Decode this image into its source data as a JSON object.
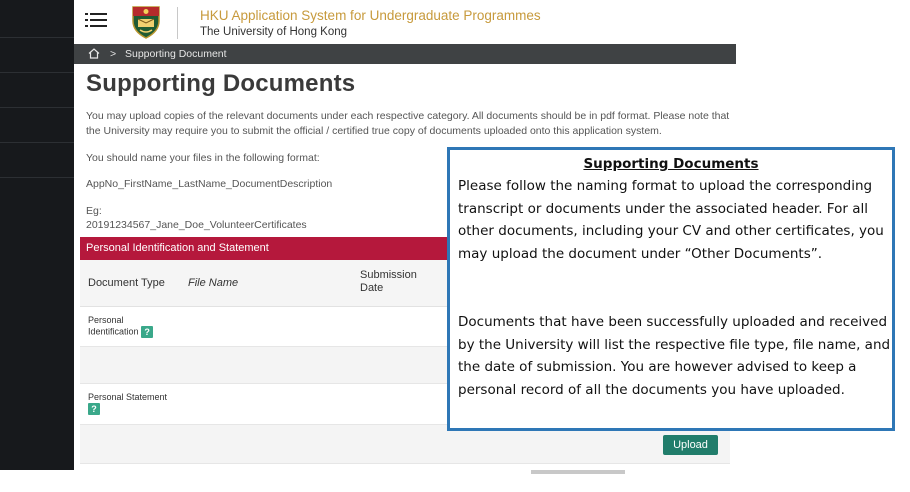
{
  "header": {
    "app_title": "HKU Application System for Undergraduate Programmes",
    "university": "The University of Hong Kong"
  },
  "breadcrumb": {
    "current": "Supporting Document"
  },
  "page": {
    "title": "Supporting Documents",
    "intro": "You may upload copies of the relevant documents under each respective category. All documents should be in pdf format. Please note that the University may require you to submit the official / certified true copy of documents uploaded onto this application system.",
    "naming_hint": "You should name your files in the following format:",
    "naming_format": "AppNo_FirstName_LastName_DocumentDescription",
    "eg_label": "Eg:",
    "eg_value": "20191234567_Jane_Doe_VolunteerCertificates"
  },
  "section": {
    "title": "Personal Identification and Statement",
    "columns": {
      "doc_type": "Document Type",
      "file_name": "File Name",
      "submission_date": "Submission Date"
    },
    "rows": [
      {
        "label": "Personal Identification",
        "help": "?"
      },
      {
        "label": "Personal Statement",
        "help": "?"
      }
    ],
    "upload_label": "Upload"
  },
  "callout": {
    "title": "Supporting Documents",
    "paragraph1": "Please follow the naming format to upload the corresponding transcript or documents under the associated header.  For all other documents, including your CV and other certificates, you may upload the document under “Other Documents”.",
    "paragraph2": "Documents that have been successfully uploaded and received by the University will list the respective file type, file name, and the date of submission. You are however advised to keep a personal record of all the documents you have uploaded."
  },
  "colors": {
    "sidebar": "#17191c",
    "section_bar": "#b5183c",
    "upload_button": "#217d6b",
    "help_icon": "#3aa88a",
    "callout_border": "#2e77b6",
    "app_title": "#c79a3c"
  },
  "icons": {
    "menu": "menu-icon",
    "crest": "hku-crest-icon",
    "home": "home-icon",
    "help": "help-icon"
  }
}
